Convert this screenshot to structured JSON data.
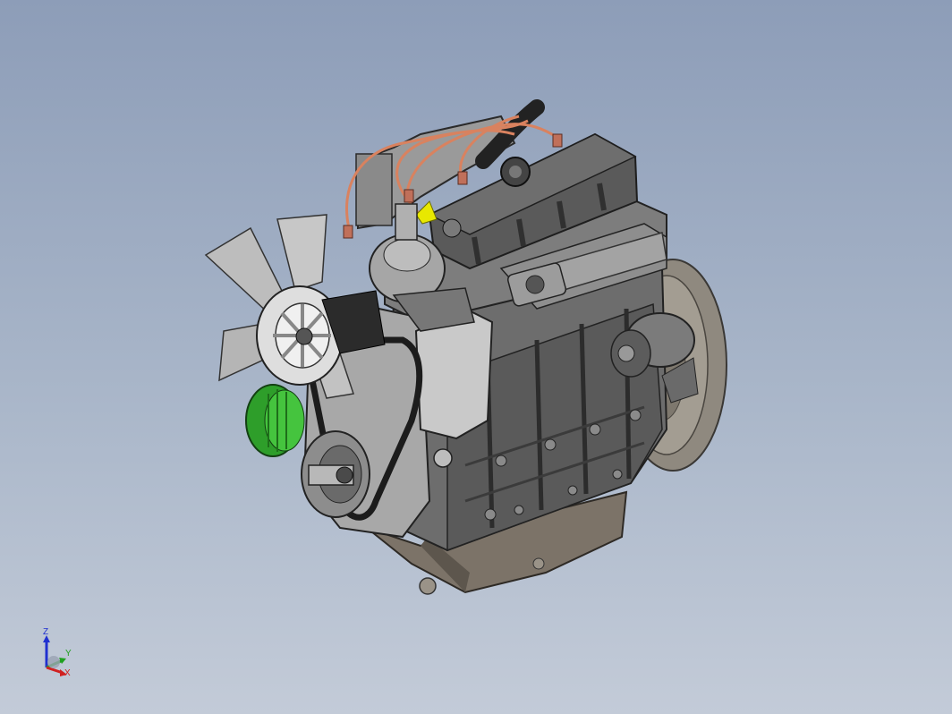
{
  "viewport": {
    "background_top": "#8d9db8",
    "background_bottom": "#c3cbd8"
  },
  "model": {
    "subject": "engine-assembly",
    "colors": {
      "block": "#6f6f6f",
      "block_shadow": "#3a3a3a",
      "valve_cover": "#585858",
      "oil_pan": "#7a7166",
      "fan": "#c9c9c9",
      "oil_filter": "#2fa52a",
      "spark_wires": "#d9825f",
      "belt": "#202020",
      "flywheel_housing": "#8a847a",
      "highlight": "#e8e800"
    }
  },
  "triad": {
    "z_label": "Z",
    "y_label": "Y",
    "x_label": "X",
    "z_color": "#2030d0",
    "y_color": "#20a020",
    "x_color": "#d02020"
  }
}
